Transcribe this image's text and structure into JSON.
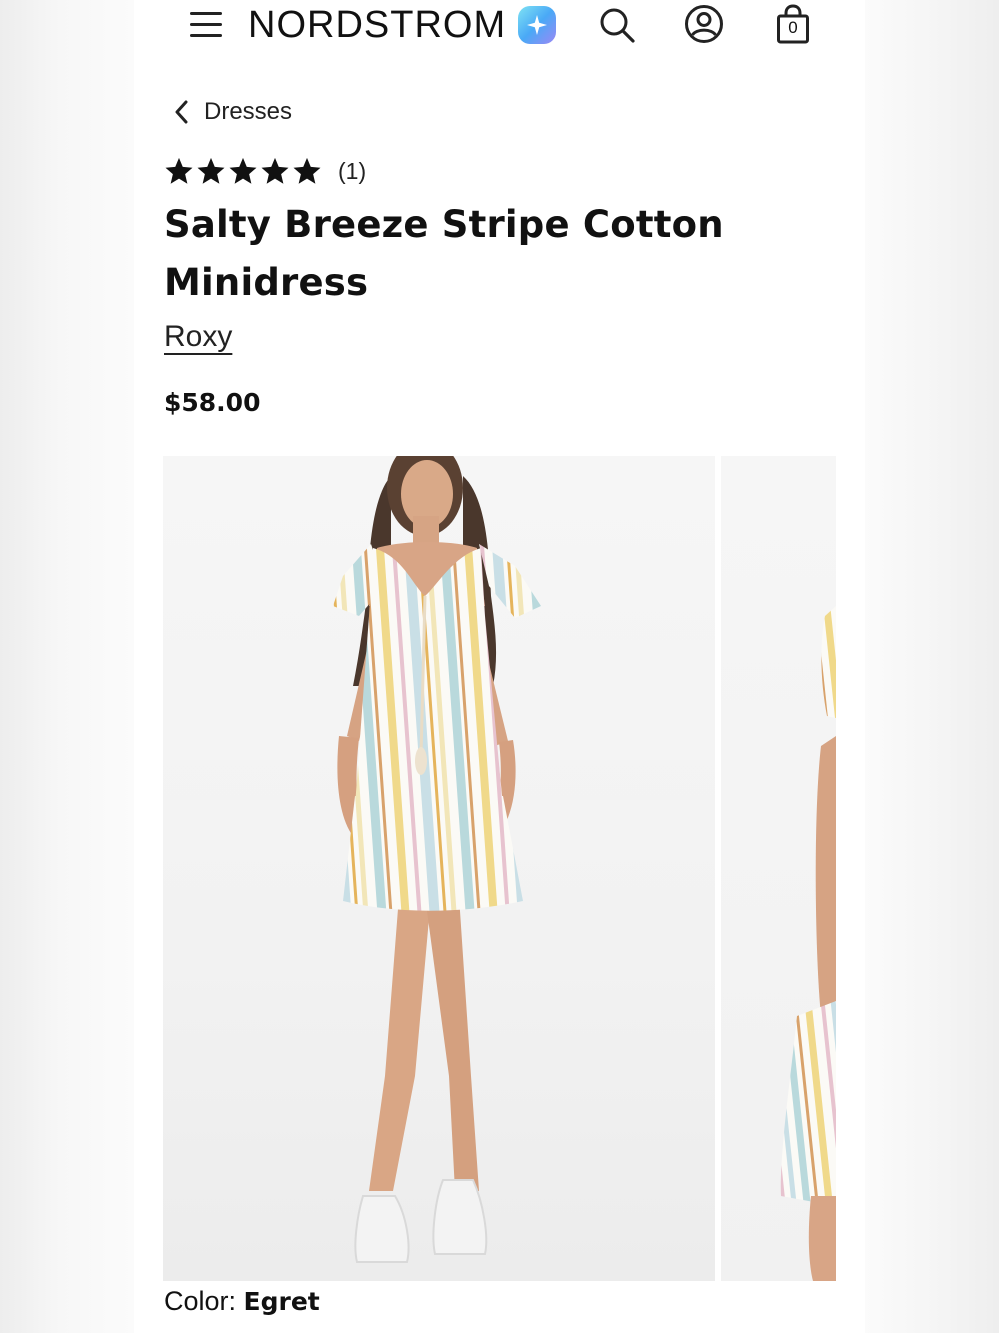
{
  "header": {
    "logo_text": "NORDSTROM",
    "bag_count": "0",
    "icons": [
      "menu-icon",
      "sparkle-ai-icon",
      "search-icon",
      "account-icon",
      "shopping-bag-icon"
    ]
  },
  "breadcrumb": {
    "label": "Dresses"
  },
  "product": {
    "rating_stars": 5,
    "rating_max": 5,
    "review_count": "(1)",
    "title": "Salty Breeze Stripe Cotton Minidress",
    "brand": "Roxy",
    "price": "$58.00",
    "color_label": "Color:",
    "color_value": "Egret"
  },
  "colors": {
    "text": "#111111",
    "ai_gradient_start": "#7fe3f4",
    "ai_gradient_end": "#9a88f5",
    "page_background": "#ffffff"
  }
}
